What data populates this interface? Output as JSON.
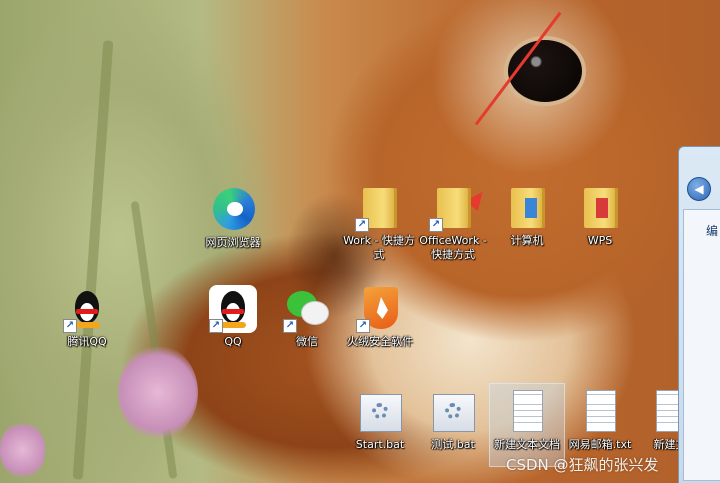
{
  "desktop": {
    "icons": [
      {
        "label": "网页浏览器",
        "icon": "edge-browser-icon",
        "shortcut": false
      },
      {
        "label": "Work - 快捷方式",
        "icon": "folder-icon",
        "shortcut": true
      },
      {
        "label": "OfficeWork - 快捷方式",
        "icon": "folder-icon",
        "shortcut": true
      },
      {
        "label": "计算机",
        "icon": "computer-folder-icon",
        "shortcut": false
      },
      {
        "label": "WPS",
        "icon": "wps-folder-icon",
        "shortcut": false
      },
      {
        "label": "腾讯QQ",
        "icon": "qq-penguin-icon",
        "shortcut": true
      },
      {
        "label": "QQ",
        "icon": "qq-penguin-icon",
        "shortcut": true
      },
      {
        "label": "微信",
        "icon": "wechat-icon",
        "shortcut": true
      },
      {
        "label": "火绒安全软件",
        "icon": "huorong-icon",
        "shortcut": true
      },
      {
        "label": "Start.bat",
        "icon": "batch-file-icon",
        "shortcut": false
      },
      {
        "label": "测试.bat",
        "icon": "batch-file-icon",
        "shortcut": false
      },
      {
        "label": "新建文本文档",
        "icon": "text-file-icon",
        "shortcut": false
      },
      {
        "label": "网易邮箱.txt",
        "icon": "text-file-icon",
        "shortcut": false
      },
      {
        "label": "新建文",
        "icon": "text-file-icon",
        "shortcut": false
      }
    ]
  },
  "explorer": {
    "pane_text": "编"
  },
  "watermark": "CSDN @狂飙的张兴发",
  "colors": {
    "annotation_arrow": "#e53a2e",
    "label_text": "#ffffff"
  }
}
